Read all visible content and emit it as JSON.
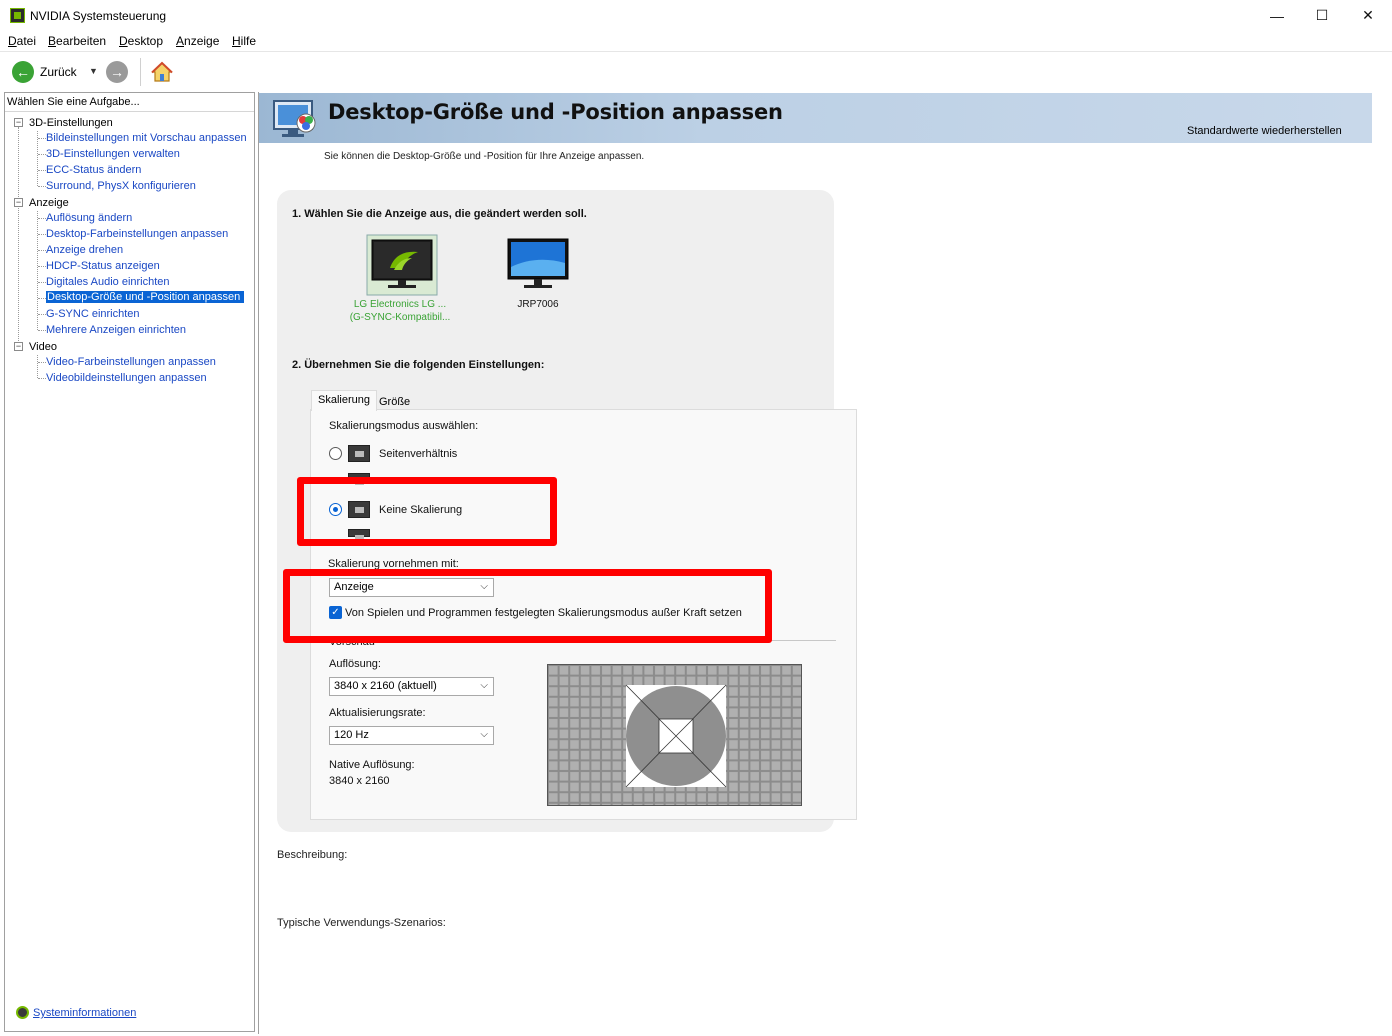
{
  "window": {
    "title": "NVIDIA Systemsteuerung",
    "controls": {
      "minimize": "—",
      "maximize": "☐",
      "close": "✕"
    }
  },
  "menu": [
    {
      "label": "Datei",
      "mnemonic": "D",
      "rest": "atei"
    },
    {
      "label": "Bearbeiten",
      "mnemonic": "B",
      "rest": "earbeiten"
    },
    {
      "label": "Desktop",
      "mnemonic": "D",
      "rest": "esktop"
    },
    {
      "label": "Anzeige",
      "mnemonic": "A",
      "rest": "nzeige"
    },
    {
      "label": "Hilfe",
      "mnemonic": "H",
      "rest": "ilfe"
    }
  ],
  "toolbar": {
    "back_label": "Zurück",
    "back_glyph": "←",
    "forward_glyph": "→",
    "dropdown_glyph": "▼"
  },
  "sidebar": {
    "header": "Wählen Sie eine Aufgabe...",
    "categories": [
      {
        "label": "3D-Einstellungen",
        "toggle": "−",
        "items": [
          "Bildeinstellungen mit Vorschau anpassen",
          "3D-Einstellungen verwalten",
          "ECC-Status ändern",
          "Surround, PhysX konfigurieren"
        ]
      },
      {
        "label": "Anzeige",
        "toggle": "−",
        "items": [
          "Auflösung ändern",
          "Desktop-Farbeinstellungen anpassen",
          "Anzeige drehen",
          "HDCP-Status anzeigen",
          "Digitales Audio einrichten",
          "Desktop-Größe und -Position anpassen",
          "G-SYNC einrichten",
          "Mehrere Anzeigen einrichten"
        ]
      },
      {
        "label": "Video",
        "toggle": "−",
        "items": [
          "Video-Farbeinstellungen anpassen",
          "Videobildeinstellungen anpassen"
        ]
      }
    ],
    "selected_item": "Desktop-Größe und -Position anpassen",
    "footer_link": "Systeminformationen"
  },
  "page": {
    "title": "Desktop-Größe und -Position anpassen",
    "restore_link": "Standardwerte wiederherstellen",
    "description": "Sie können die Desktop-Größe und -Position für Ihre Anzeige anpassen.",
    "step1": "1. Wählen Sie die Anzeige aus, die geändert werden soll.",
    "monitors": [
      {
        "line1": "LG Electronics LG ...",
        "line2": "(G-SYNC-Kompatibil...",
        "selected": true
      },
      {
        "line1": "JRP7006",
        "line2": "",
        "selected": false
      }
    ],
    "step2": "2. Übernehmen Sie die folgenden Einstellungen:",
    "tabs": [
      "Skalierung",
      "Größe"
    ],
    "scaling_mode_label": "Skalierungsmodus auswählen:",
    "modes": [
      {
        "label": "Seitenverhältnis",
        "checked": false
      },
      {
        "label": "Keine Skalierung",
        "checked": true
      }
    ],
    "perform_with_label": "Skalierung vornehmen mit:",
    "perform_with_value": "Anzeige",
    "override_checkbox": {
      "label": "Von Spielen und Programmen festgelegten Skalierungsmodus außer Kraft setzen",
      "checked": true,
      "glyph": "✓"
    },
    "preview_label": "Vorschau",
    "resolution_label": "Auflösung:",
    "resolution_value": "3840 x 2160 (aktuell)",
    "refresh_label": "Aktualisierungsrate:",
    "refresh_value": "120 Hz",
    "native_label": "Native Auflösung:",
    "native_value": "3840 x 2160",
    "chevron": "⌵"
  },
  "bottom": {
    "description_label": "Beschreibung:",
    "scenarios_label": "Typische Verwendungs-Szenarios:"
  },
  "colors": {
    "accent": "#0a64d4",
    "nvidia_green": "#76b900",
    "annotation_red": "#ff0000"
  }
}
